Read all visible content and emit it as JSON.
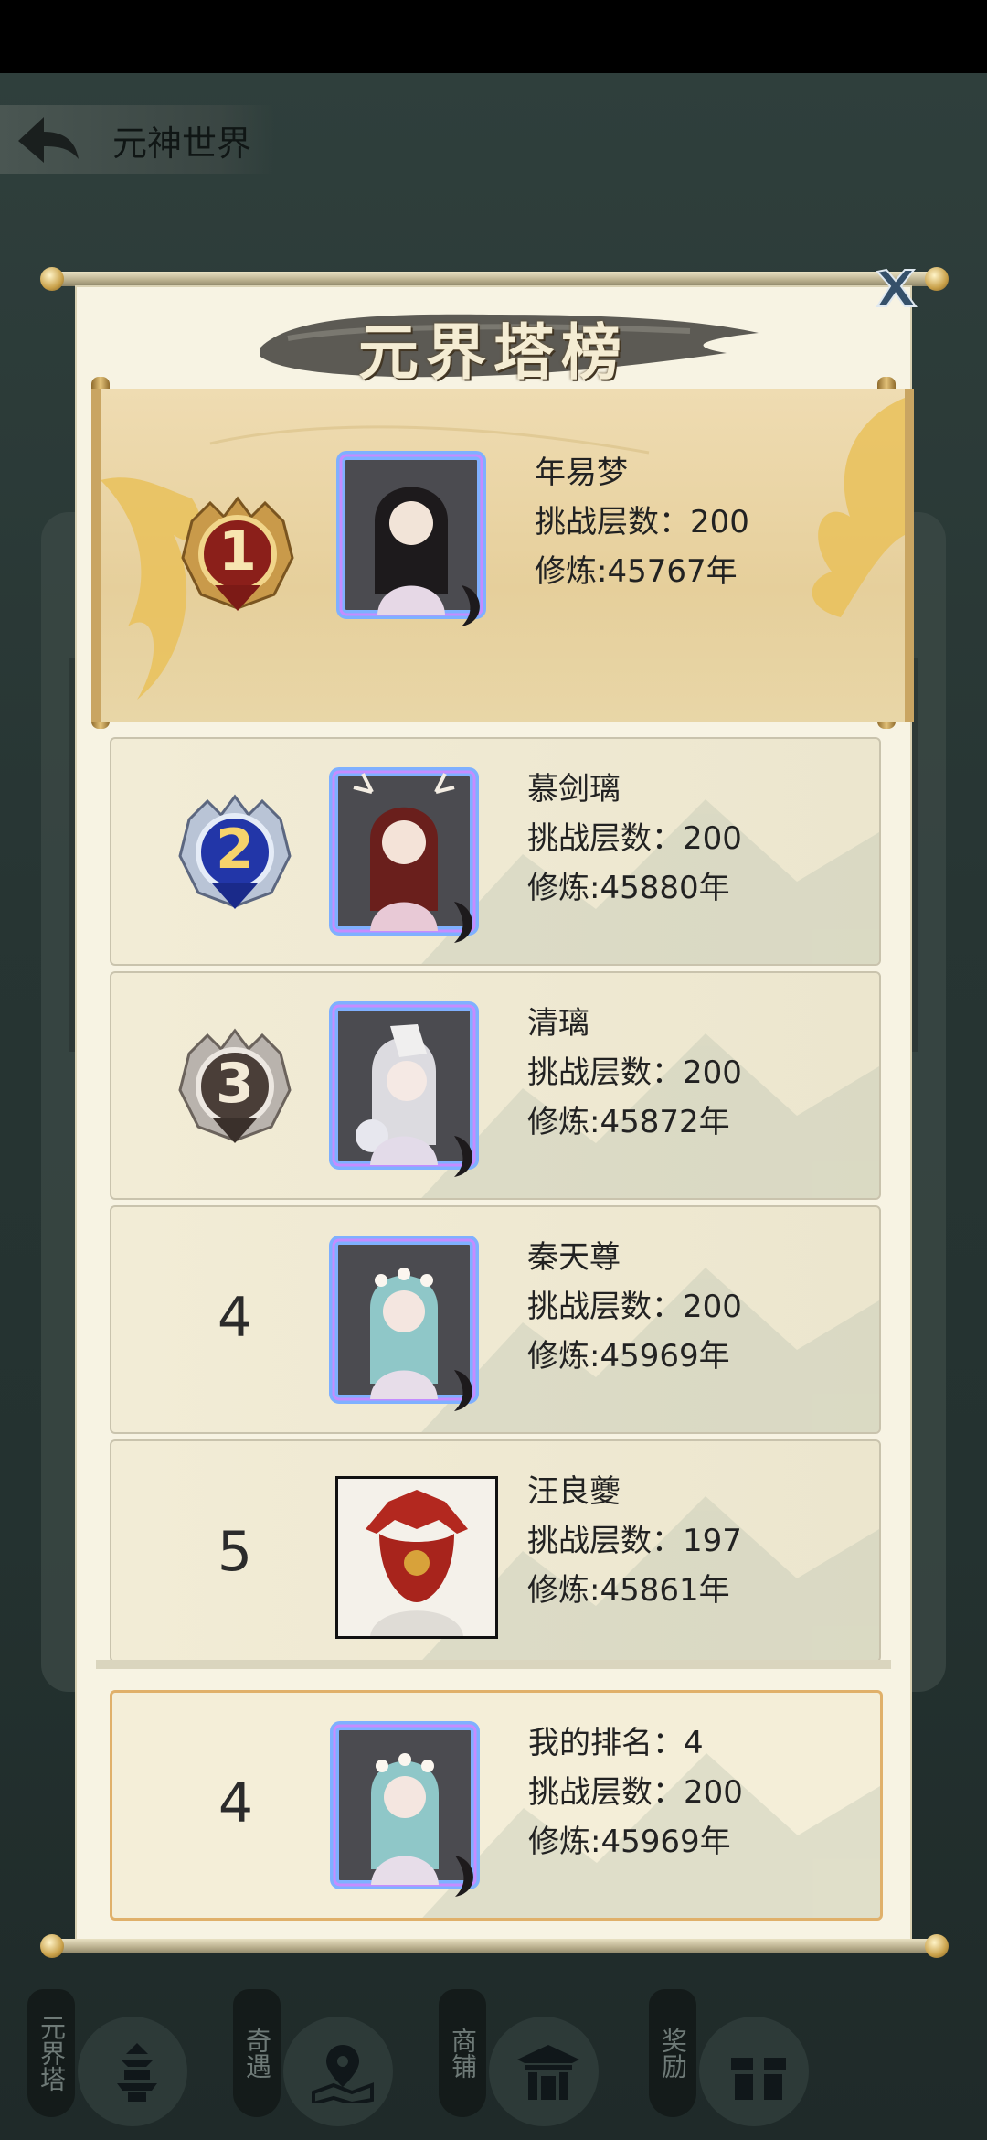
{
  "topbar": {
    "title": "元神世界"
  },
  "modal": {
    "title": "元界塔榜"
  },
  "rankings": [
    {
      "rank": "1",
      "name": "年易梦",
      "floors": "挑战层数：200",
      "cultivation": "修炼:45767年"
    },
    {
      "rank": "2",
      "name": "慕剑璃",
      "floors": "挑战层数：200",
      "cultivation": "修炼:45880年"
    },
    {
      "rank": "3",
      "name": "清璃",
      "floors": "挑战层数：200",
      "cultivation": "修炼:45872年"
    },
    {
      "rank": "4",
      "name": "秦天尊",
      "floors": "挑战层数：200",
      "cultivation": "修炼:45969年"
    },
    {
      "rank": "5",
      "name": "汪良夔",
      "floors": "挑战层数：197",
      "cultivation": "修炼:45861年"
    }
  ],
  "my_rank": {
    "rank": "4",
    "label": "我的排名：4",
    "floors": "挑战层数：200",
    "cultivation": "修炼:45969年"
  },
  "bottom_nav": [
    {
      "label": "元界塔",
      "icon": "pagoda-icon"
    },
    {
      "label": "奇遇",
      "icon": "map-pin-icon"
    },
    {
      "label": "商铺",
      "icon": "shop-icon"
    },
    {
      "label": "奖励",
      "icon": "reward-chest-icon"
    }
  ],
  "colors": {
    "gold": "#c9a562",
    "panel": "#f7f3e3",
    "frame_glow": "#8fb4ff"
  }
}
